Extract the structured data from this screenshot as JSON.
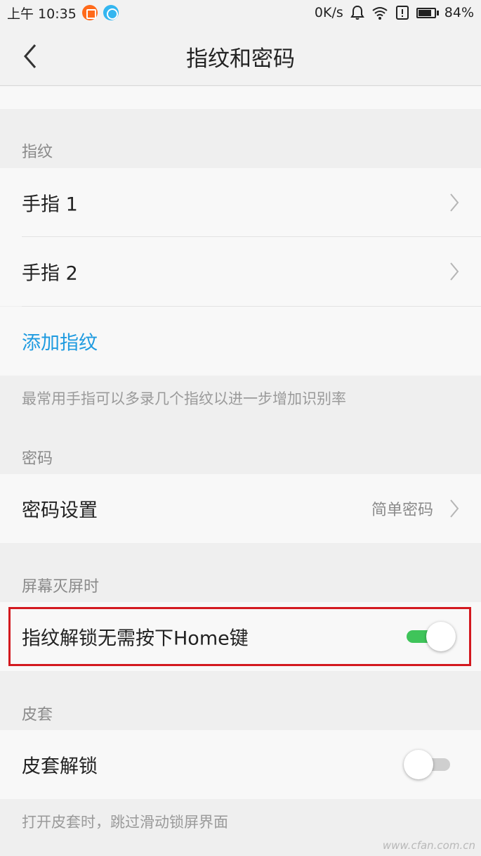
{
  "status_bar": {
    "time": "上午 10:35",
    "network_speed": "0K/s",
    "battery_percent": "84%",
    "battery_level": 0.84
  },
  "header": {
    "title": "指纹和密码"
  },
  "fingerprint_section": {
    "header": "指纹",
    "items": [
      {
        "label": "手指 1"
      },
      {
        "label": "手指 2"
      }
    ],
    "add_label": "添加指纹",
    "hint": "最常用手指可以多录几个指纹以进一步增加识别率"
  },
  "password_section": {
    "header": "密码",
    "setting_label": "密码设置",
    "setting_value": "简单密码"
  },
  "screen_off_section": {
    "header": "屏幕灭屏时",
    "toggle_label": "指纹解锁无需按下Home键",
    "toggle_on": true
  },
  "cover_section": {
    "header": "皮套",
    "toggle_label": "皮套解锁",
    "toggle_on": false,
    "hint": "打开皮套时，跳过滑动锁屏界面"
  },
  "watermark": "www.cfan.com.cn",
  "colors": {
    "accent": "#1f9be0",
    "toggle_on": "#3fc45a",
    "highlight": "#d3191f"
  }
}
